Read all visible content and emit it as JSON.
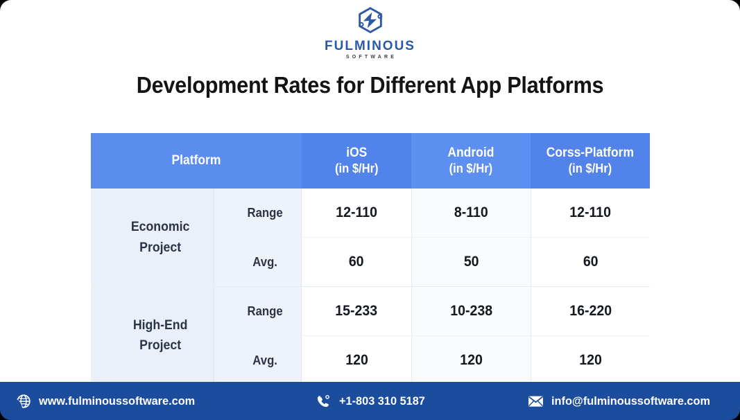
{
  "brand": {
    "logo_icon": "fulminous-hexagon-bolt-logo",
    "wordmark": "FULMINOUS",
    "subword": "SOFTWARE",
    "logo_color": "#2b58a8"
  },
  "title": "Development Rates for Different App Platforms",
  "table": {
    "columns": [
      {
        "label": "Platform",
        "sub": "",
        "bg": "#5b8def"
      },
      {
        "label": "iOS",
        "sub": "(in $/Hr)",
        "bg": "#5183ea"
      },
      {
        "label": "Android",
        "sub": "(in $/Hr)",
        "bg": "#5d8ff0"
      },
      {
        "label": "Corss-Platform",
        "sub": "(in $/Hr)",
        "bg": "#5183ea"
      }
    ],
    "groups": [
      {
        "name_line1": "Economic",
        "name_line2": "Project",
        "rows": [
          {
            "metric": "Range",
            "ios": "12-110",
            "android": "8-110",
            "cross": "12-110"
          },
          {
            "metric": "Avg.",
            "ios": "60",
            "android": "50",
            "cross": "60"
          }
        ]
      },
      {
        "name_line1": "High-End",
        "name_line2": "Project",
        "rows": [
          {
            "metric": "Range",
            "ios": "15-233",
            "android": "10-238",
            "cross": "16-220"
          },
          {
            "metric": "Avg.",
            "ios": "120",
            "android": "120",
            "cross": "120"
          }
        ]
      }
    ]
  },
  "footer": {
    "background": "#1c4c9c",
    "website": {
      "icon": "globe-icon",
      "text": "www.fulminoussoftware.com"
    },
    "phone": {
      "icon": "phone-icon",
      "text": "+1-803 310 5187"
    },
    "email": {
      "icon": "envelope-icon",
      "text": "info@fulminoussoftware.com"
    }
  }
}
